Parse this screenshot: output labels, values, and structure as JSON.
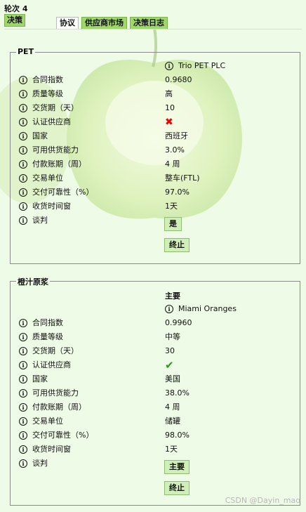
{
  "header": {
    "round": "轮次 4",
    "decision_tab": "决策",
    "tabs": [
      {
        "label": "协议",
        "active": true
      },
      {
        "label": "供应商市场",
        "active": false
      },
      {
        "label": "决策日志",
        "active": false
      }
    ]
  },
  "pet": {
    "title": "PET",
    "supplier": "Trio PET PLC",
    "labels": [
      "合同指数",
      "质量等级",
      "交货期（天）",
      "认证供应商",
      "国家",
      "可用供货能力",
      "付款账期（周）",
      "交易单位",
      "交付可靠性（%）",
      "收货时间窗",
      "谈判"
    ],
    "values": {
      "contract_index": "0.9680",
      "quality": "高",
      "lead_time": "10",
      "certified_icon": "cross-icon",
      "country": "西班牙",
      "capacity": "3.0%",
      "payment": "4 周",
      "unit": "整车(FTL)",
      "reliability": "97.0%",
      "window": "1天"
    },
    "negotiate_btn": "是",
    "stop_btn": "终止"
  },
  "orange": {
    "title": "橙汁原浆",
    "header": "主要",
    "supplier": "Miami Oranges",
    "labels": [
      "合同指数",
      "质量等级",
      "交货期（天）",
      "认证供应商",
      "国家",
      "可用供货能力",
      "付款账期（周）",
      "交易单位",
      "交付可靠性（%）",
      "收货时间窗",
      "谈判"
    ],
    "values": {
      "contract_index": "0.9960",
      "quality": "中等",
      "lead_time": "30",
      "certified_icon": "check-icon",
      "country": "美国",
      "capacity": "38.0%",
      "payment": "4 周",
      "unit": "储罐",
      "reliability": "98.0%",
      "window": "1天"
    },
    "negotiate_btn": "主要",
    "stop_btn": "终止"
  },
  "watermark": "CSDN @Dayin_mao",
  "colors": {
    "background": "#eefbe6",
    "tab_green": "#9fd76a",
    "cross": "#e00000",
    "check": "#2c9a1a"
  }
}
